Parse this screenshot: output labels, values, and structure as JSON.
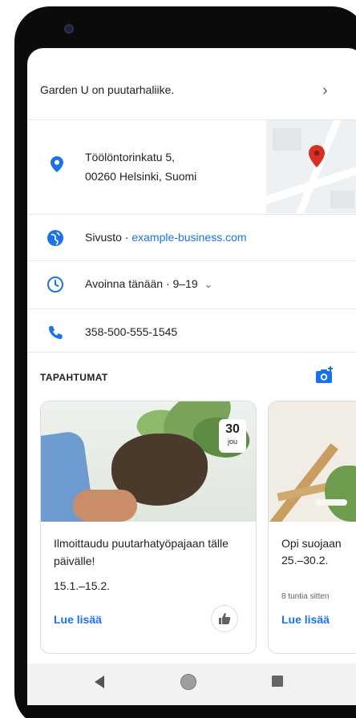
{
  "business": {
    "description": "Garden U on puutarhaliike.",
    "address_line1": "Töölöntorinkatu 5,",
    "address_line2": "00260 Helsinki, Suomi",
    "website_label": "Sivusto · ",
    "website_url": "example-business.com",
    "hours_text": "Avoinna tänään · 9–19",
    "phone": "358-500-555-1545"
  },
  "events": {
    "header": "TAPAHTUMAT",
    "cards": [
      {
        "title": "Ilmoittaudu puutarhatyöpajaan tälle päivälle!",
        "date_day": "30",
        "date_month": "jou",
        "range": "15.1.–15.2.",
        "more": "Lue lisää"
      },
      {
        "title": "Opi suojaan",
        "range": "25.–30.2.",
        "ago": "8 tuntia sitten",
        "more": "Lue lisää"
      }
    ]
  },
  "icons": {
    "pin": "location-pin-icon",
    "web": "globe-icon",
    "clock": "clock-icon",
    "phone": "phone-icon",
    "camera": "add-photo-icon",
    "like": "thumbs-up-icon"
  },
  "colors": {
    "accent": "#1a73e8",
    "map_pin": "#d93025"
  }
}
